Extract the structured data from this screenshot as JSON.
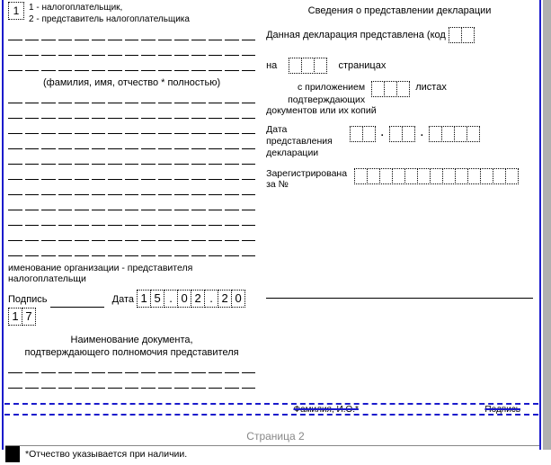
{
  "left": {
    "code_box": "1",
    "legend_line1": "1 - налогоплательщик,",
    "legend_line2": "2 - представитель налогоплательщика",
    "fio_caption": "(фамилия, имя, отчество * полностью)",
    "org_caption": "именование организации - представителя налогоплательщи",
    "signature_label": "Подпись",
    "date_label": "Дата",
    "date_digits": [
      "1",
      "5",
      ".",
      "0",
      "2",
      ".",
      "2",
      "0",
      "1",
      "7"
    ],
    "doc_title": "Наименование документа,",
    "doc_subtitle": "подтверждающего полномочия представителя"
  },
  "right": {
    "title": "Сведения о представлении декларации",
    "submitted_label": "Данная декларация представлена (код",
    "on_label": "на",
    "pages_label": "страницах",
    "attach_line1": "с приложением",
    "attach_line2": "подтверждающих",
    "sheets_label": "листах",
    "attach_bottom": "документов или их копий",
    "decl_date_label": "Дата представления декларации",
    "reg_label": "Зарегистрирована за №",
    "bottom_left": "Фамилия, И.О.*",
    "bottom_right": "Подпись"
  },
  "page_label": "Страница 2",
  "footnote": "Отчество указывается при наличии."
}
